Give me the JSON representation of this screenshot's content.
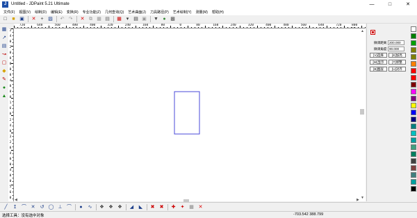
{
  "window": {
    "title": "Untitled - JDPaint 5.21 Ultimate"
  },
  "menu": [
    "文件(F)",
    "视图(V)",
    "绘制(D)",
    "编辑(E)",
    "变换(R)",
    "专业功能(Z)",
    "几何查询(Q)",
    "艺术曲面(J)",
    "刀具路径(P)",
    "艺术绘制(Y)",
    "测量(M)",
    "帮助(H)"
  ],
  "ruler": {
    "h_labels": [
      "720",
      "640",
      "560",
      "480",
      "400",
      "320",
      "240",
      "160",
      "80",
      "0",
      "80",
      "160",
      "240",
      "320",
      "400",
      "480",
      "560",
      "640",
      "720",
      "800 mm"
    ],
    "v_labels": [
      "2",
      "4",
      "0",
      "2",
      "0",
      "0",
      "0",
      "8",
      "0",
      "4",
      "0",
      "8",
      "0",
      "1",
      "6",
      "0",
      "2",
      "4",
      "0",
      "3",
      "2",
      "0",
      "4",
      "0",
      "0",
      "4",
      "8",
      "0",
      "5",
      "6",
      "0"
    ]
  },
  "panel": {
    "distance_label": "微调距离",
    "distance_value": "200.000",
    "angle_label": "微调角度",
    "angle_value": "90.000",
    "buttons": [
      "[V]选择",
      "[E]加亮",
      "[W]显示",
      "[T]修整",
      "[B]图层",
      "[U]对齐"
    ]
  },
  "palette_colors": [
    "#ffffff",
    "#008000",
    "#00a000",
    "#808000",
    "#808000",
    "#ff8000",
    "#ff0000",
    "#ff0000",
    "#800000",
    "#ff00ff",
    "#800080",
    "#ffff00",
    "#0000ff",
    "#000080",
    "#008080",
    "#00c0c0",
    "#00a0a0",
    "#40a080",
    "#008060",
    "#404040",
    "#804040",
    "#408080",
    "#00a0a0",
    "#000000"
  ],
  "status": {
    "text": "选择工具：没有选中对象",
    "coords": "-703.542 388.799"
  },
  "icons": {
    "toolbar": [
      "new-file-icon",
      "open-folder-icon",
      "save-icon",
      "delete-icon",
      "add-cross-icon",
      "select-arrow-icon",
      "undo-icon",
      "redo-icon",
      "cut-icon",
      "copy-icon",
      "paste-icon",
      "print-icon",
      "grid-icon",
      "layer-icon",
      "zoom-in-icon",
      "zoom-out-icon",
      "shield-icon",
      "palette-icon",
      "settings-icon"
    ],
    "left": [
      "select-rect-icon",
      "node-edit-icon",
      "table-icon",
      "bend-icon",
      "frame-icon",
      "rotate-icon",
      "pen-icon",
      "color-fill-icon",
      "tree-icon"
    ],
    "bottom": [
      "line-icon",
      "curve-icon",
      "arc-icon",
      "cross-icon",
      "rotate-icon",
      "circle-icon",
      "perpendicular-icon",
      "arc-tool-icon",
      "dot-icon",
      "wave-icon",
      "node-icon",
      "node-icon",
      "node-icon",
      "scale-icon",
      "mirror-icon",
      "delete-node-icon",
      "array-icon",
      "move-icon",
      "explode-icon",
      "trim-icon",
      "close-icon"
    ]
  }
}
